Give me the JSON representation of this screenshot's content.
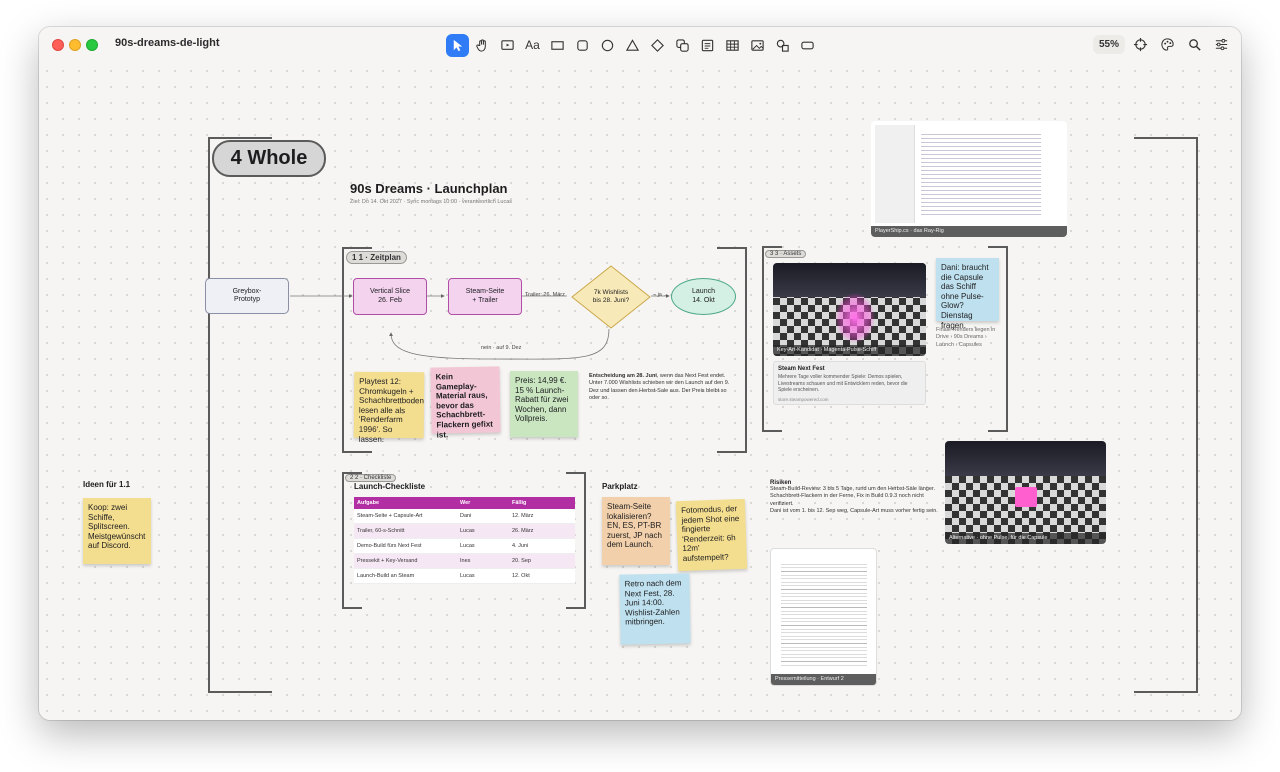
{
  "window": {
    "title": "90s-dreams-de-light"
  },
  "toolbar": {
    "tools": [
      "pointer-icon",
      "hand-icon",
      "presentation-icon",
      "text-tool",
      "rectangle-icon",
      "rounded-rect-icon",
      "ellipse-icon",
      "triangle-icon",
      "diamond-icon",
      "copy-shapes-icon",
      "note-icon",
      "table-icon",
      "image-icon",
      "shapes-icon",
      "frame-icon"
    ],
    "text_tool_label": "Aa",
    "zoom": "55%"
  },
  "canvas": {
    "section_pill": "4  Whole",
    "title": "90s Dreams · Launchplan",
    "subtitle": "Ziel: Do 14. Okt 2027 · Sync montags 10:00 · verantwortlich Lucas",
    "zeitplan_tag": "1  1 · Zeitplan",
    "assets_tag": "3  3 · Assets",
    "checklist_tag": "2  2 · Checkliste",
    "flow": {
      "greybox": "Greybox-Prototyp",
      "vertical_slice": "Vertical Slice\n26. Feb",
      "steam_page": "Steam-Seite\n+ Trailer",
      "trailer_label": "Trailer: 26. März",
      "decision": "7k Wishlists\nbis 28. Juni?",
      "ja_label": "– ja →",
      "launch": "Launch\n14. Okt",
      "nein_label": "nein · auf 9. Dez"
    },
    "stickies_zeitplan": [
      "Playtest 12: Chromkugeln + Schachbrettboden lesen alle als 'Renderfarm 1996'. So lassen.",
      "Kein Gameplay-Material raus, bevor das Schachbrett-Flackern gefixt ist.",
      "Preis: 14,99 €. 15 % Launch-Rabatt für zwei Wochen, dann Vollpreis."
    ],
    "decision_note_bold": "Entscheidung am 28. Juni",
    "decision_note": ", wenn das Next Fest endet. Unter 7.000 Wishlists schieben wir den Launch auf den 9. Dez und lassen den Herbst-Sale aus. Der Preis bleibt so oder so.",
    "ideas_title": "Ideen für 1.1",
    "ideas_sticky": "Koop: zwei Schiffe, Splitscreen. Meistgewünscht auf Discord.",
    "checklist": {
      "title": "Launch-Checkliste",
      "headers": [
        "Aufgabe",
        "Wer",
        "Fällig"
      ],
      "rows": [
        [
          "Steam-Seite + Capsule-Art",
          "Dani",
          "12. März"
        ],
        [
          "Trailer, 60-s-Schnitt",
          "Lucas",
          "26. März"
        ],
        [
          "Demo-Build fürs Next Fest",
          "Lucas",
          "4. Juni"
        ],
        [
          "Pressekit + Key-Versand",
          "Ines",
          "20. Sep"
        ],
        [
          "Launch-Build an Steam",
          "Lucas",
          "12. Okt"
        ]
      ]
    },
    "parkplatz": {
      "title": "Parkplatz",
      "stickies": [
        "Steam-Seite lokalisieren? EN, ES, PT-BR zuerst, JP nach dem Launch.",
        "Fotomodus, der jedem Shot eine fingierte 'Renderzeit: 6h 12m' aufstempelt?",
        "Retro nach dem Next Fest, 28. Juni 14:00. Wishlist-Zahlen mitbringen."
      ]
    },
    "assets": {
      "key_art_caption": "Key-Art-Kandidat · Magenta-Pulse-Schiff",
      "steam_card_title": "Steam Next Fest",
      "steam_card_text": "Mehrere Tage voller kommender Spiele: Demos spielen, Livestreams schauen und mit Entwicklern reden, bevor die Spiele erscheinen.",
      "steam_card_url": "store.steampowered.com",
      "dani_sticky": "Dani: braucht die Capsule das Schiff ohne Pulse-Glow? Dienstag fragen.",
      "renders_note": "Finale Renders liegen in Drive › 90s Dreams › Launch › Capsules",
      "alt_caption": "Alternative · ohne Pulse, für die Capsule",
      "code_caption": "PlayerShip.cs · das Ray-Rig"
    },
    "risks": {
      "title": "Risiken",
      "lines": [
        "Steam-Build-Review: 3 bis 5 Tage, rund um den Herbst-Sale länger.",
        "Schachbrett-Flackern in der Ferne, Fix in Build 0.9.3 noch nicht verifiziert.",
        "Dani ist vom 1. bis 12. Sep weg, Capsule-Art muss vorher fertig sein."
      ]
    },
    "press_caption": "Pressemitteilung · Entwurf 2"
  },
  "colors": {
    "accent": "#2f7cf6",
    "sticky_yellow": "#f3dd8f",
    "sticky_pink": "#f3c6d6",
    "sticky_green": "#c9e6c1",
    "sticky_orange": "#f2d0ab",
    "sticky_blue": "#bfe0ee",
    "table_header": "#b12ea3",
    "node_pink": "#f4d3ef",
    "node_yellow": "#f8e9b8",
    "node_green": "#d4efe4"
  }
}
